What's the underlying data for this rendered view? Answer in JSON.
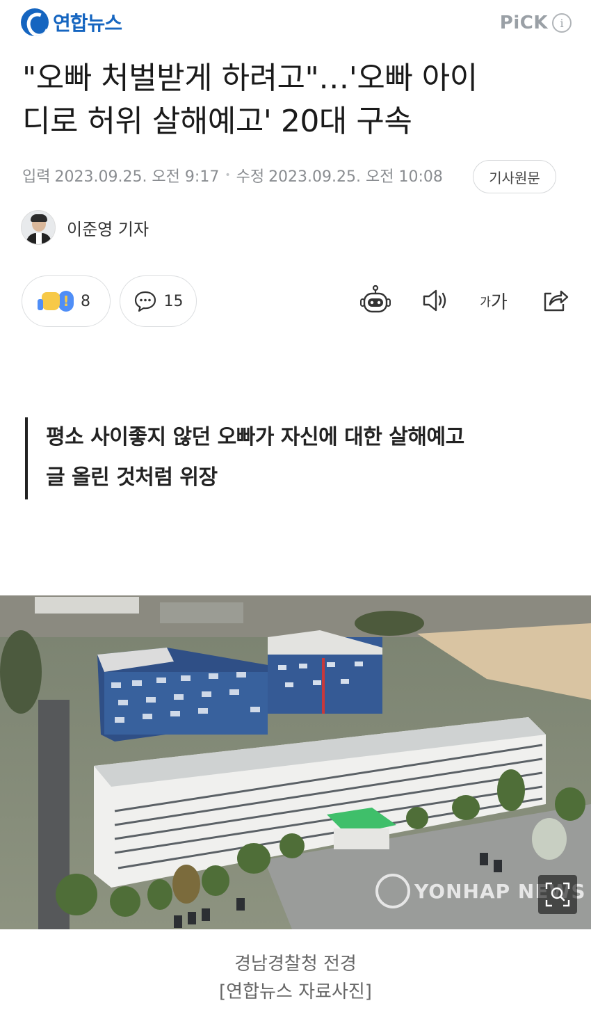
{
  "header": {
    "logo_text": "연합뉴스",
    "pick_label": "PiCK",
    "info_label": "i"
  },
  "article": {
    "headline_line1": "\"오빠 처벌받게 하려고\"…'오빠 아이",
    "headline_line2": "디로 허위 살해예고' 20대 구속",
    "input_label": "입력",
    "input_time": "2023.09.25. 오전 9:17",
    "modified_label": "수정",
    "modified_time": "2023.09.25. 오전 10:08",
    "original_button": "기사원문",
    "reporter": "이준영 기자",
    "subheadline_line1": "평소 사이좋지 않던 오빠가 자신에 대한 살해예고",
    "subheadline_line2": "글 올린 것처럼 위장",
    "photo_watermark": "YONHAP NEWS",
    "caption_line1": "경남경찰청 전경",
    "caption_line2": "[연합뉴스 자료사진]"
  },
  "actions": {
    "reaction_count": "8",
    "comment_count": "15",
    "font_size_small": "가",
    "font_size_large": "가"
  },
  "icons": {
    "logo": "yonhap-logo-icon",
    "info": "info-icon",
    "reaction": "thumbs-up-exclamation-icon",
    "comment": "speech-bubble-icon",
    "summary_bot": "robot-icon",
    "tts": "speaker-icon",
    "share": "share-icon",
    "zoom": "zoom-search-icon"
  },
  "colors": {
    "brand_blue": "#1565c0",
    "muted_text": "#8a8d91"
  }
}
